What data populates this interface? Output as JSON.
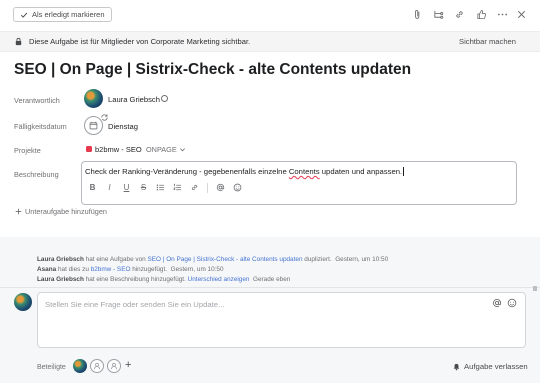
{
  "toolbar": {
    "mark_complete": "Als erledigt markieren",
    "icons": [
      "paperclip-icon",
      "subtask-icon",
      "link-icon",
      "thumbs-up-icon",
      "more-icon",
      "close-icon"
    ]
  },
  "banner": {
    "text": "Diese Aufgabe ist für Mitglieder von Corporate Marketing sichtbar.",
    "link": "Sichtbar machen"
  },
  "task": {
    "title": "SEO | On Page | Sistrix-Check - alte Contents updaten"
  },
  "fields": {
    "assignee_label": "Verantwortlich",
    "assignee_name": "Laura Griebsch",
    "due_label": "Fälligkeitsdatum",
    "due_value": "Dienstag",
    "projects_label": "Projekte",
    "project_name": "b2bmw - SEO",
    "project_section": "ONPAGE",
    "project_color": "#e8384f",
    "description_label": "Beschreibung",
    "description_before": "Check der Ranking-Veränderung - gegebenenfalls einzelne ",
    "description_misspelled": "Contents",
    "description_after": " updaten und anpassen."
  },
  "format_toolbar": {
    "bold": "B",
    "italic": "I",
    "underline": "U",
    "strike": "S"
  },
  "subtask": {
    "label": "Unteraufgabe hinzufügen"
  },
  "activity": [
    {
      "user": "Laura Griebsch",
      "text1": " hat eine Aufgabe von ",
      "link": "SEO | On Page | Sistrix-Check - alte Contents updaten",
      "text2": " dupliziert.",
      "time": "Gestern, um 10:50"
    },
    {
      "user": "Asana",
      "text1": " hat dies zu ",
      "link": "b2bmw - SEO",
      "text2": " hinzugefügt.",
      "time": "Gestern, um 10:50"
    },
    {
      "user": "Laura Griebsch",
      "text1": " hat eine Beschreibung hinzugefügt. ",
      "link": "Unterschied anzeigen",
      "text2": "",
      "time": "Gerade eben"
    }
  ],
  "comment": {
    "placeholder": "Stellen Sie eine Frage oder senden Sie ein Update..."
  },
  "followers": {
    "label": "Beteiligte",
    "add": "+",
    "leave": "Aufgabe verlassen"
  }
}
